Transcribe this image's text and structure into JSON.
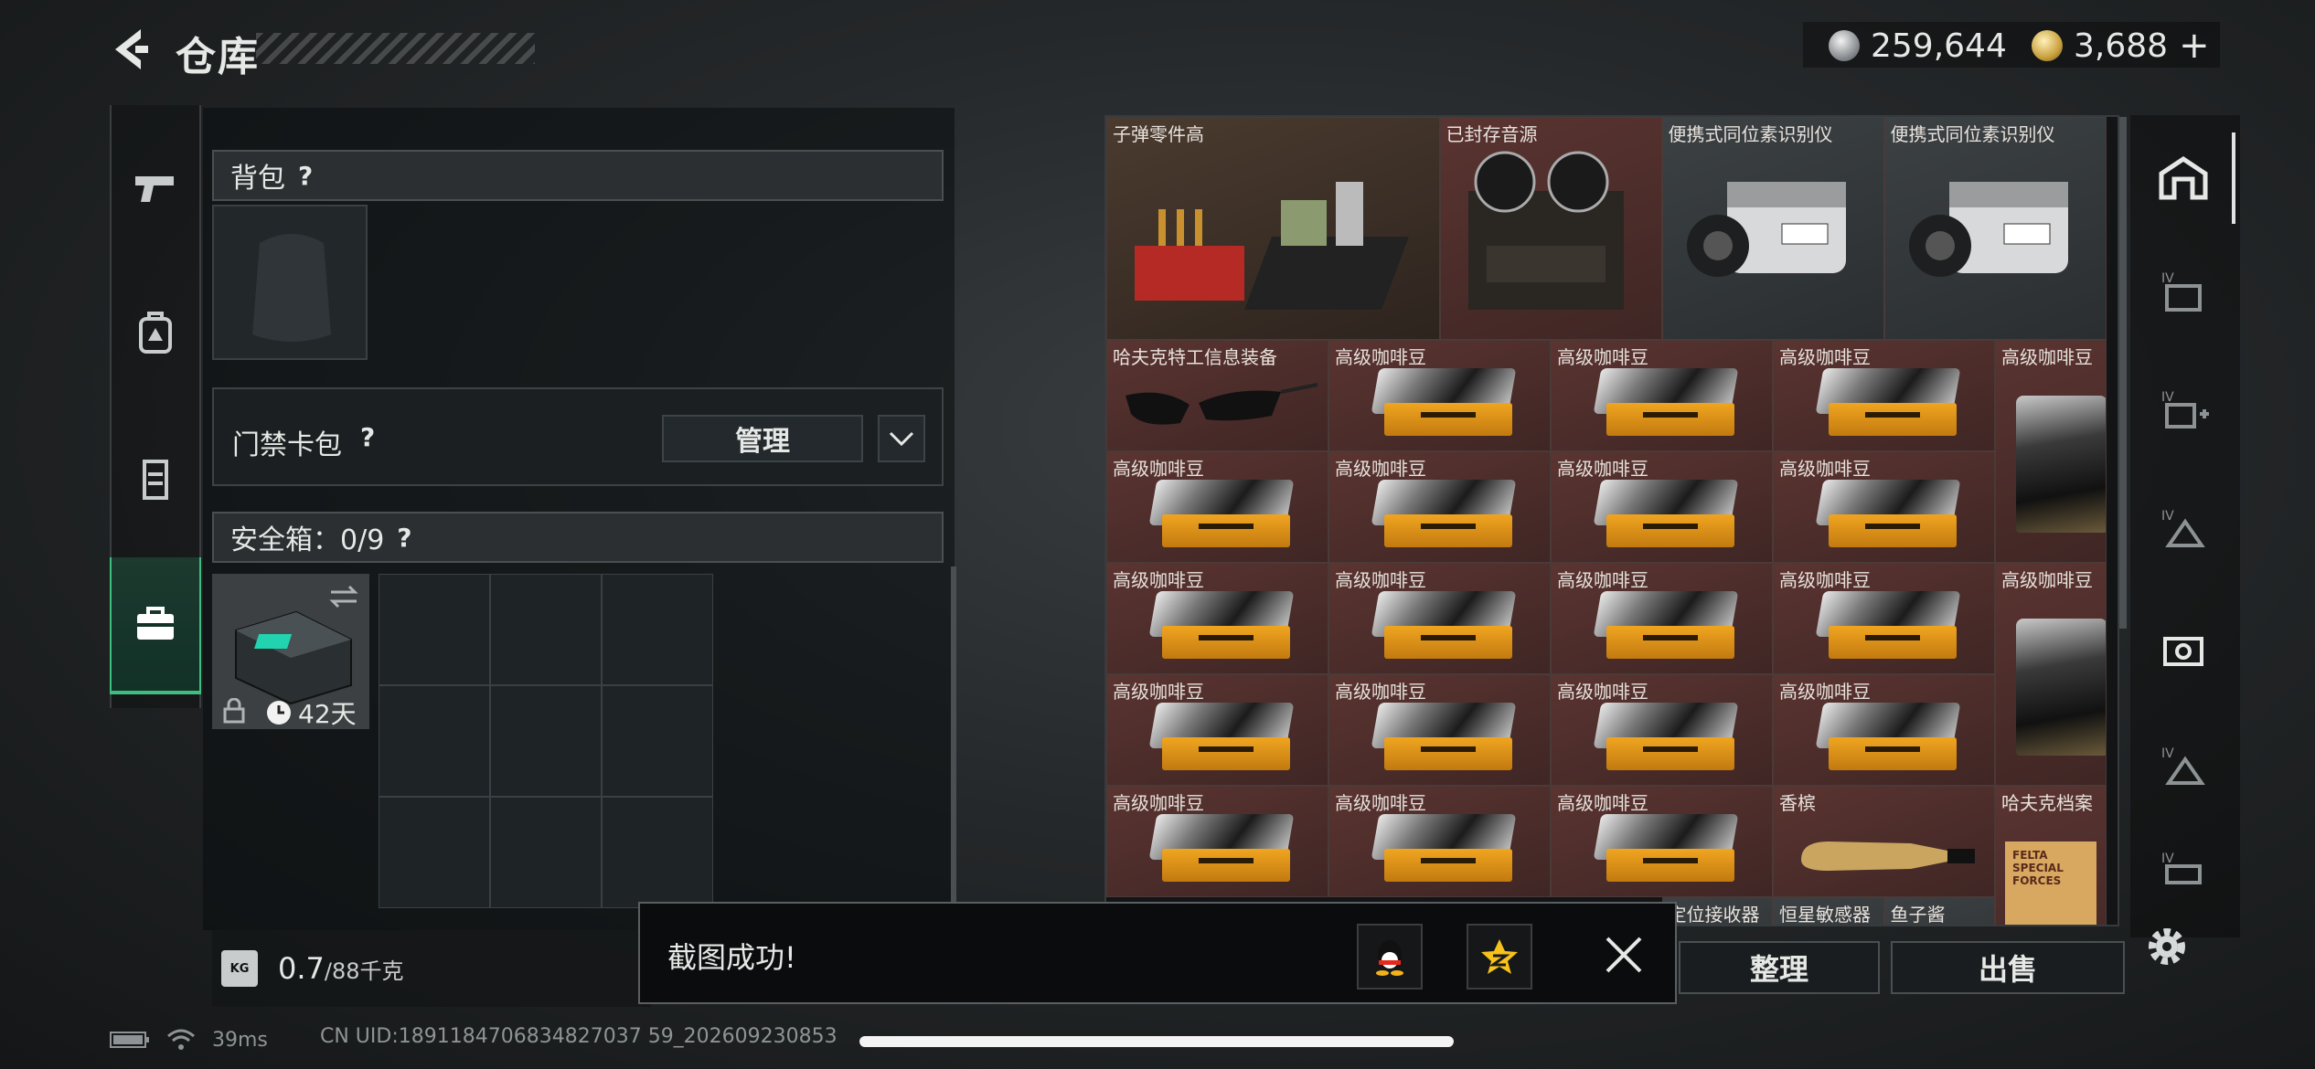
{
  "header": {
    "title": "仓库",
    "currency_silver": "259,644",
    "currency_gold": "3,688",
    "add_label": "+"
  },
  "backpack": {
    "label": "背包",
    "help": "?"
  },
  "keycard": {
    "label": "门禁卡包",
    "help": "?",
    "manage_label": "管理"
  },
  "safebox": {
    "label": "安全箱：0/9",
    "help": "?",
    "duration": "42天"
  },
  "weight": {
    "current": "0.7",
    "max": "/88千克",
    "icon_text": "KG"
  },
  "inventory": {
    "items": [
      {
        "label": "子弹零件高",
        "col": 0,
        "row": 0,
        "w": 1.5,
        "h": 2,
        "style": "brown",
        "art": "ammo"
      },
      {
        "label": "已封存音源",
        "col": 1.5,
        "row": 0,
        "w": 1,
        "h": 2,
        "style": "red",
        "art": "tape"
      },
      {
        "label": "便携式同位素识别仪",
        "col": 2.5,
        "row": 0,
        "w": 1,
        "h": 2,
        "style": "gray",
        "art": "device"
      },
      {
        "label": "便携式同位素识别仪",
        "col": 3.5,
        "row": 0,
        "w": 1,
        "h": 2,
        "style": "gray",
        "art": "device"
      },
      {
        "label": "哈夫克特工信息装备",
        "col": 0,
        "row": 2,
        "w": 1,
        "h": 1,
        "style": "red",
        "art": "glasses"
      },
      {
        "label": "高级咖啡豆",
        "col": 1,
        "row": 2,
        "w": 1,
        "h": 1,
        "style": "red",
        "art": "bag"
      },
      {
        "label": "高级咖啡豆",
        "col": 2,
        "row": 2,
        "w": 1,
        "h": 1,
        "style": "red",
        "art": "bag"
      },
      {
        "label": "高级咖啡豆",
        "col": 3,
        "row": 2,
        "w": 1,
        "h": 1,
        "style": "red",
        "art": "bag"
      },
      {
        "label": "高级咖啡豆",
        "col": 4,
        "row": 2,
        "w": 0.5,
        "h": 2,
        "style": "red",
        "art": "tall"
      },
      {
        "label": "高级咖啡豆",
        "col": 0,
        "row": 3,
        "w": 1,
        "h": 1,
        "style": "red",
        "art": "bag"
      },
      {
        "label": "高级咖啡豆",
        "col": 1,
        "row": 3,
        "w": 1,
        "h": 1,
        "style": "red",
        "art": "bag"
      },
      {
        "label": "高级咖啡豆",
        "col": 2,
        "row": 3,
        "w": 1,
        "h": 1,
        "style": "red",
        "art": "bag"
      },
      {
        "label": "高级咖啡豆",
        "col": 3,
        "row": 3,
        "w": 1,
        "h": 1,
        "style": "red",
        "art": "bag"
      },
      {
        "label": "高级咖啡豆",
        "col": 0,
        "row": 4,
        "w": 1,
        "h": 1,
        "style": "red",
        "art": "bag"
      },
      {
        "label": "高级咖啡豆",
        "col": 1,
        "row": 4,
        "w": 1,
        "h": 1,
        "style": "red",
        "art": "bag"
      },
      {
        "label": "高级咖啡豆",
        "col": 2,
        "row": 4,
        "w": 1,
        "h": 1,
        "style": "red",
        "art": "bag"
      },
      {
        "label": "高级咖啡豆",
        "col": 3,
        "row": 4,
        "w": 1,
        "h": 1,
        "style": "red",
        "art": "bag"
      },
      {
        "label": "高级咖啡豆",
        "col": 4,
        "row": 4,
        "w": 0.5,
        "h": 2,
        "style": "red",
        "art": "tall"
      },
      {
        "label": "高级咖啡豆",
        "col": 0,
        "row": 5,
        "w": 1,
        "h": 1,
        "style": "red",
        "art": "bag"
      },
      {
        "label": "高级咖啡豆",
        "col": 1,
        "row": 5,
        "w": 1,
        "h": 1,
        "style": "red",
        "art": "bag"
      },
      {
        "label": "高级咖啡豆",
        "col": 2,
        "row": 5,
        "w": 1,
        "h": 1,
        "style": "red",
        "art": "bag"
      },
      {
        "label": "高级咖啡豆",
        "col": 3,
        "row": 5,
        "w": 1,
        "h": 1,
        "style": "red",
        "art": "bag"
      },
      {
        "label": "高级咖啡豆",
        "col": 0,
        "row": 6,
        "w": 1,
        "h": 1,
        "style": "red",
        "art": "bag"
      },
      {
        "label": "高级咖啡豆",
        "col": 1,
        "row": 6,
        "w": 1,
        "h": 1,
        "style": "red",
        "art": "bag"
      },
      {
        "label": "高级咖啡豆",
        "col": 2,
        "row": 6,
        "w": 1,
        "h": 1,
        "style": "red",
        "art": "bag"
      },
      {
        "label": "香槟",
        "col": 3,
        "row": 6,
        "w": 1,
        "h": 1,
        "style": "red",
        "art": "bottle"
      },
      {
        "label": "哈夫克档案",
        "col": 4,
        "row": 6,
        "w": 0.5,
        "h": 2,
        "style": "red",
        "art": "folder"
      },
      {
        "label": "定位接收器",
        "col": 2.5,
        "row": 7,
        "w": 0.5,
        "h": 1,
        "style": "gray",
        "art": "none"
      },
      {
        "label": "恒星敏感器",
        "col": 3,
        "row": 7,
        "w": 0.5,
        "h": 1,
        "style": "gray",
        "art": "none"
      },
      {
        "label": "鱼子酱",
        "col": 3.5,
        "row": 7,
        "w": 0.5,
        "h": 1,
        "style": "gray",
        "art": "none"
      }
    ],
    "folder_text": "FELTA SPECIAL FORCES"
  },
  "actions": {
    "sort_label": "整理",
    "sell_label": "出售"
  },
  "toast": {
    "message": "截图成功!"
  },
  "status": {
    "ping": "39ms",
    "uid": "CN UID:1891184706834827037 59_202609230853"
  },
  "colors": {
    "accent_green": "#3fbf7f",
    "item_red": "#5a3431",
    "item_gold": "#f0a520"
  },
  "icons": [
    "back-arrow-icon",
    "pistol-icon",
    "backpack-icon",
    "armor-icon",
    "briefcase-icon",
    "warehouse-icon",
    "gear-icon",
    "qq-icon",
    "qzone-icon",
    "close-icon",
    "lock-icon",
    "clock-icon",
    "swap-icon",
    "battery-icon",
    "wifi-icon"
  ]
}
